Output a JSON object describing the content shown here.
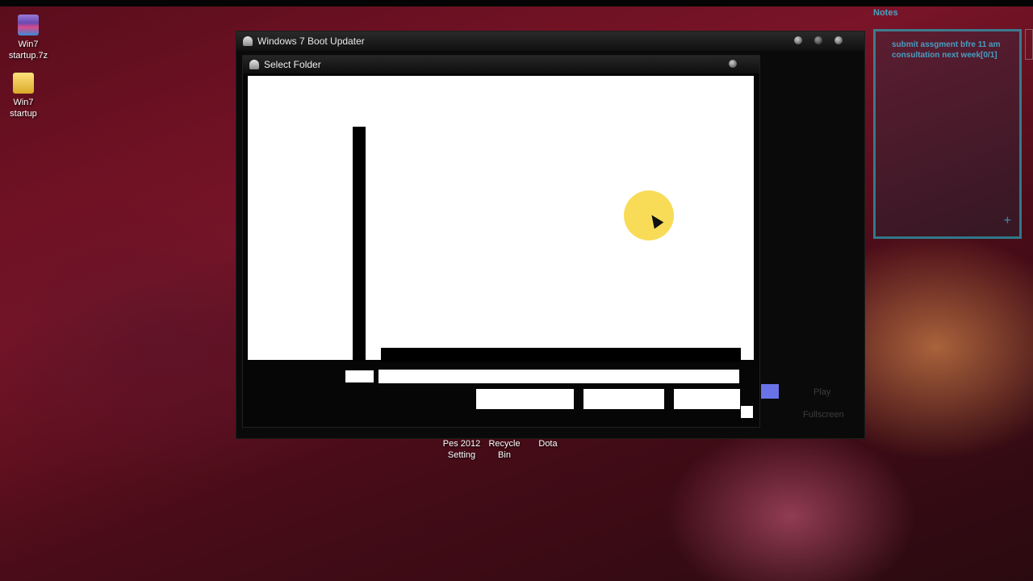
{
  "desktop": {
    "icons": [
      {
        "label": "Win7\nstartup.7z",
        "icon": "archive-icon"
      },
      {
        "label": "Win7\nstartup",
        "icon": "folder-icon"
      }
    ],
    "bottom_labels": [
      {
        "label": "Pes 2012\nSetting"
      },
      {
        "label": "Recycle Bin"
      },
      {
        "label": "Dota"
      }
    ]
  },
  "notes": {
    "title": "Notes",
    "text": "submit assgment bfre 11 am\nconsultation next week[0/1]",
    "add_symbol": "+"
  },
  "main_window": {
    "title": "Windows 7 Boot Updater",
    "side_buttons": {
      "play": "Play",
      "fullscreen": "Fullscreen"
    },
    "accent_color": "#6a72e8"
  },
  "dialog": {
    "title": "Select Folder"
  }
}
